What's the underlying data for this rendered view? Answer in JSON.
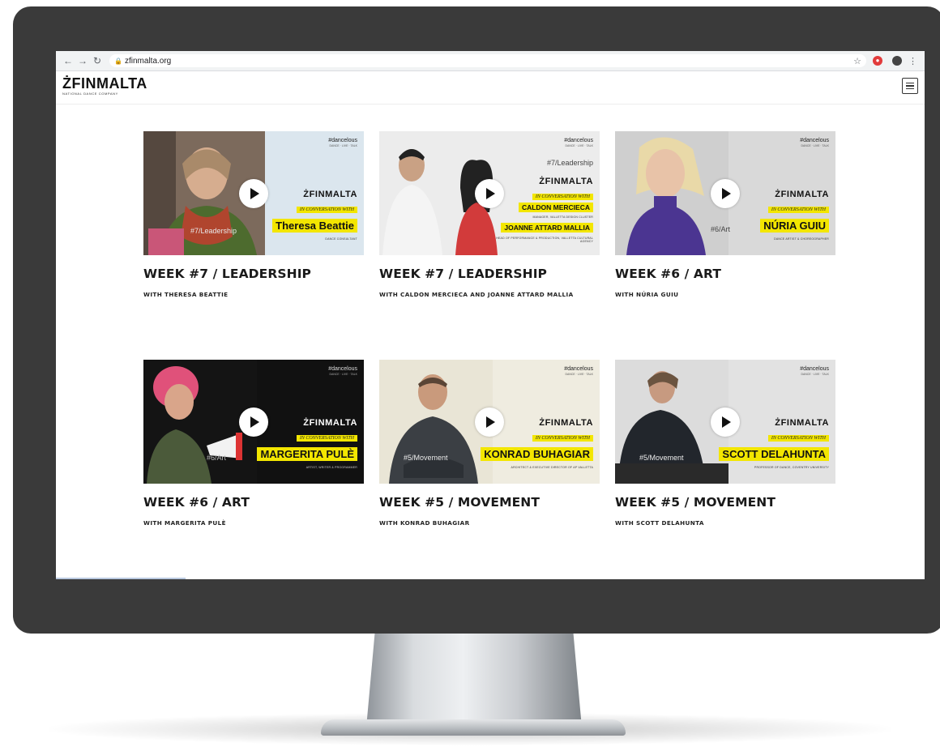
{
  "browser": {
    "url": "zfinmalta.org"
  },
  "site": {
    "logo": "ŻFINMALTA",
    "logo_sub": "NATIONAL DANCE COMPANY"
  },
  "thumb_common": {
    "hashtag": "#dancelous",
    "brand": "ŻFINMALTA",
    "conversation": "IN CONVERSATION WITH"
  },
  "cards": [
    {
      "title": "WEEK #7 / LEADERSHIP",
      "subtitle": "WITH THERESA BEATTIE",
      "names": [
        "Theresa Beattie"
      ],
      "tagline": "#7/Leadership",
      "caption": "DANCE CONSULTANT",
      "bg": "#dbe6ee",
      "photo": "#c59c7c"
    },
    {
      "title": "WEEK #7 / LEADERSHIP",
      "subtitle": "WITH CALDON MERCIECA AND JOANNE ATTARD MALLIA",
      "names": [
        "CALDON MERCIECA",
        "JOANNE ATTARD MALLIA"
      ],
      "tagline": "#7/Leadership",
      "caption": "HEAD OF PERFORMANCE & PRODUCTION, VALLETTA CULTURAL AGENCY",
      "caption2": "MANAGER, VALLETTA DESIGN CLUSTER",
      "bg": "#ececec",
      "photo": "#d8b8a0"
    },
    {
      "title": "WEEK #6 / ART",
      "subtitle": "WITH NÚRIA GUIU",
      "names": [
        "NÚRIA GUIU"
      ],
      "tagline": "#6/Art",
      "caption": "DANCE ARTIST & CHOREOGRAPHER",
      "bg": "#d9d9d9",
      "photo": "#5a3e8c"
    },
    {
      "title": "WEEK #6 / ART",
      "subtitle": "WITH MARGERITA PULÈ",
      "names": [
        "MARGERITA PULÈ"
      ],
      "tagline": "#6/Art",
      "caption": "ARTIST, WRITER & PROGRAMMER",
      "bg": "#111111",
      "photo": "#e0517a"
    },
    {
      "title": "WEEK #5 / MOVEMENT",
      "subtitle": "WITH KONRAD BUHAGIAR",
      "names": [
        "KONRAD BUHAGIAR"
      ],
      "tagline": "#5/Movement",
      "caption": "ARCHITECT & EXECUTIVE DIRECTOR OF AP VALLETTA",
      "bg": "#efece0",
      "photo": "#3b3f44"
    },
    {
      "title": "WEEK #5 / MOVEMENT",
      "subtitle": "WITH SCOTT DELAHUNTA",
      "names": [
        "SCOTT DELAHUNTA"
      ],
      "tagline": "#5/Movement",
      "caption": "PROFESSOR OF DANCE, COVENTRY UNIVERSITY",
      "bg": "#e2e2e2",
      "photo": "#262a30"
    }
  ],
  "colors": {
    "bezel": "#3a3a3a",
    "highlight": "#f3e600"
  },
  "icons": [
    "back-icon",
    "forward-icon",
    "reload-icon",
    "lock-icon",
    "star-icon",
    "extension-icon",
    "profile-icon",
    "menu-icon",
    "hamburger-icon",
    "play-icon"
  ]
}
